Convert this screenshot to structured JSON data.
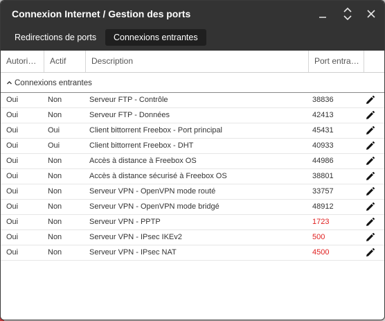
{
  "window": {
    "title": "Connexion Internet / Gestion des ports",
    "controls": {
      "minimize_icon": "minimize-icon",
      "maximize_icon": "expand-icon",
      "close_icon": "close-icon"
    }
  },
  "tabs": [
    {
      "label": "Redirections de ports",
      "active": false
    },
    {
      "label": "Connexions entrantes",
      "active": true
    }
  ],
  "columns": [
    "Autori…",
    "Actif",
    "Description",
    "Port entra…"
  ],
  "group": {
    "label": "Connexions entrantes"
  },
  "colors": {
    "accent_dark": "#333333",
    "highlight_port": "#e02020"
  },
  "rows": [
    {
      "autorise": "Oui",
      "actif": "Non",
      "description": "Serveur FTP - Contrôle",
      "port": "38836",
      "highlight": false
    },
    {
      "autorise": "Oui",
      "actif": "Non",
      "description": "Serveur FTP - Données",
      "port": "42413",
      "highlight": false
    },
    {
      "autorise": "Oui",
      "actif": "Oui",
      "description": "Client bittorrent Freebox - Port principal",
      "port": "45431",
      "highlight": false
    },
    {
      "autorise": "Oui",
      "actif": "Oui",
      "description": "Client bittorrent Freebox - DHT",
      "port": "40933",
      "highlight": false
    },
    {
      "autorise": "Oui",
      "actif": "Non",
      "description": "Accès à distance à Freebox OS",
      "port": "44986",
      "highlight": false
    },
    {
      "autorise": "Oui",
      "actif": "Non",
      "description": "Accès à distance sécurisé à Freebox OS",
      "port": "38801",
      "highlight": false
    },
    {
      "autorise": "Oui",
      "actif": "Non",
      "description": "Serveur VPN - OpenVPN mode routé",
      "port": "33757",
      "highlight": false
    },
    {
      "autorise": "Oui",
      "actif": "Non",
      "description": "Serveur VPN - OpenVPN mode bridgé",
      "port": "48912",
      "highlight": false
    },
    {
      "autorise": "Oui",
      "actif": "Non",
      "description": "Serveur VPN - PPTP",
      "port": "1723",
      "highlight": true
    },
    {
      "autorise": "Oui",
      "actif": "Non",
      "description": "Serveur VPN - IPsec IKEv2",
      "port": "500",
      "highlight": true
    },
    {
      "autorise": "Oui",
      "actif": "Non",
      "description": "Serveur VPN - IPsec NAT",
      "port": "4500",
      "highlight": true
    }
  ]
}
